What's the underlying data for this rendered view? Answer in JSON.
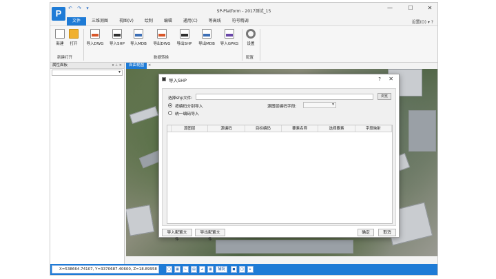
{
  "app": {
    "logo_letter": "P",
    "window_title": "SP-Platform - 2017测试_15",
    "qat": [
      "↶",
      "↷",
      "▾"
    ],
    "window_controls": [
      "—",
      "☐",
      "✕"
    ]
  },
  "ribbon": {
    "tabs": [
      {
        "label": "文件",
        "active": true
      },
      {
        "label": "三维测图",
        "active": false
      },
      {
        "label": "视图(V)",
        "active": false
      },
      {
        "label": "绘制",
        "active": false
      },
      {
        "label": "编辑",
        "active": false
      },
      {
        "label": "通用(C)",
        "active": false
      },
      {
        "label": "等高线",
        "active": false
      },
      {
        "label": "符号精调",
        "active": false
      }
    ],
    "settings_link": "设置(O) ▾ ?",
    "buttons": {
      "new": "新建",
      "open": "打开",
      "import_dwg": "导入DWG",
      "import_shp": "导入SHP",
      "import_mdb": "导入MDB",
      "export_dwg": "导出DWG",
      "export_shp": "导出SHP",
      "export_mdb": "导出MDB",
      "import_gpkg": "导入GPKG",
      "settings": "设置"
    },
    "groups": {
      "new_open": "新建打开",
      "data_convert": "数据转换",
      "config": "配置"
    }
  },
  "left_panel": {
    "title": "属性面板",
    "pin": "▾ ⊥ ✕"
  },
  "view": {
    "tab_label": "自由视图",
    "tab_close": "✕"
  },
  "statusbar": {
    "coords": "X=538664.74107, Y=3370687.40600, Z=18.89958",
    "toggle_label": "捕捉"
  },
  "dialog": {
    "title": "导入SHP",
    "help": "?",
    "close": "✕",
    "select_file_label": "选择shp文件:",
    "file_value": "",
    "browse_label": "浏览",
    "radio_by_code": "按编码分别导入",
    "radio_unified": "统一编码导入",
    "source_field_label": "源图层编码字段:",
    "source_field_value": "",
    "columns": [
      "源图层",
      "源编码",
      "目标编码",
      "要素名称",
      "选择要素",
      "字段映射"
    ],
    "btn_import_config": "导入配置文件",
    "btn_export_config": "导出配置文件",
    "btn_ok": "确定",
    "btn_cancel": "取消"
  }
}
